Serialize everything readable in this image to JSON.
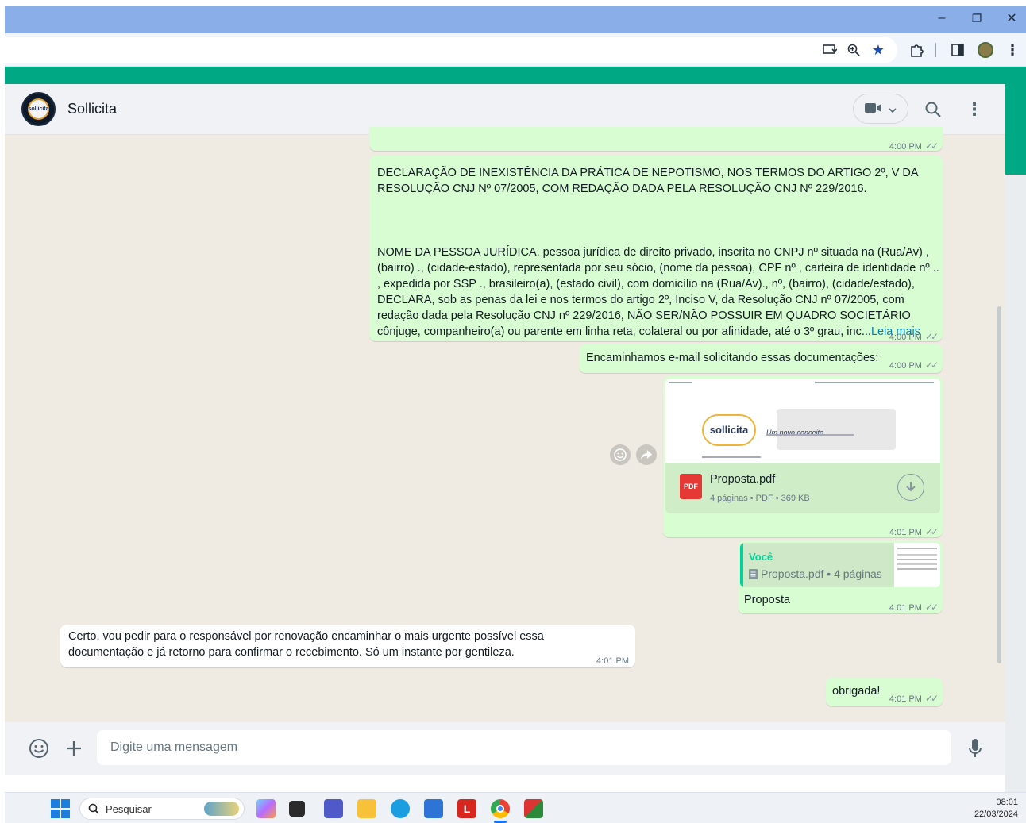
{
  "browser": {
    "minimize": "–",
    "restore": "❐",
    "close": "✕"
  },
  "chat": {
    "contact_name": "Sollicita",
    "avatar_text": "sollicita"
  },
  "messages": [
    {
      "id": "m1",
      "time": "4:00 PM"
    },
    {
      "id": "m2",
      "paragraph1": "DECLARAÇÃO DE INEXISTÊNCIA DA PRÁTICA DE NEPOTISMO, NOS TERMOS DO ARTIGO 2º, V DA RESOLUÇÃO CNJ Nº 07/2005, COM REDAÇÃO DADA PELA RESOLUÇÃO CNJ Nº 229/2016.",
      "paragraph2": "NOME DA PESSOA JURÍDICA, pessoa jurídica de direito privado, inscrita no CNPJ nº situada na (Rua/Av) , (bairro) ., (cidade-estado), representada por seu sócio, (nome da pessoa), CPF nº , carteira de identidade nº .. , expedida por SSP ., brasileiro(a), (estado civil), com domicílio na (Rua/Av)., nº, (bairro), (cidade/estado), DECLARA, sob as penas da lei e nos termos do artigo 2º, Inciso V, da Resolução CNJ nº 07/2005, com redação dada pela Resolução CNJ nº 229/2016, NÃO SER/NÃO POSSUIR EM QUADRO SOCIETÁRIO cônjuge, companheiro(a) ou parente em linha reta, colateral ou por afinidade, até o 3º grau, inc...",
      "read_more": "Leia mais",
      "time": "4:00 PM"
    },
    {
      "id": "m3",
      "text": "Encaminhamos e-mail solicitando essas documentações:",
      "time": "4:00 PM"
    },
    {
      "id": "m4",
      "preview_brand": "sollicita",
      "preview_tagline": "Um novo conceito",
      "file_name": "Proposta.pdf",
      "file_meta": "4 páginas • PDF • 369 KB",
      "pdf_label": "PDF",
      "time": "4:01 PM"
    },
    {
      "id": "m5",
      "quote_author": "Você",
      "quote_file": "Proposta.pdf • 4 páginas",
      "text": "Proposta",
      "time": "4:01 PM"
    },
    {
      "id": "m6",
      "text": "Certo, vou pedir para o responsável por renovação encaminhar o mais urgente possível essa documentação e já retorno para confirmar o recebimento. Só um instante por gentileza.",
      "time": "4:01 PM"
    },
    {
      "id": "m7",
      "text": "obrigada!",
      "time": "4:01 PM"
    }
  ],
  "composer": {
    "placeholder": "Digite uma mensagem"
  },
  "taskbar": {
    "search_label": "Pesquisar",
    "time": "08:01",
    "date": "22/03/2024"
  },
  "colors": {
    "accent": "#00a884",
    "outgoing_bubble": "#d9fdd3",
    "chat_background": "#efeae2"
  }
}
